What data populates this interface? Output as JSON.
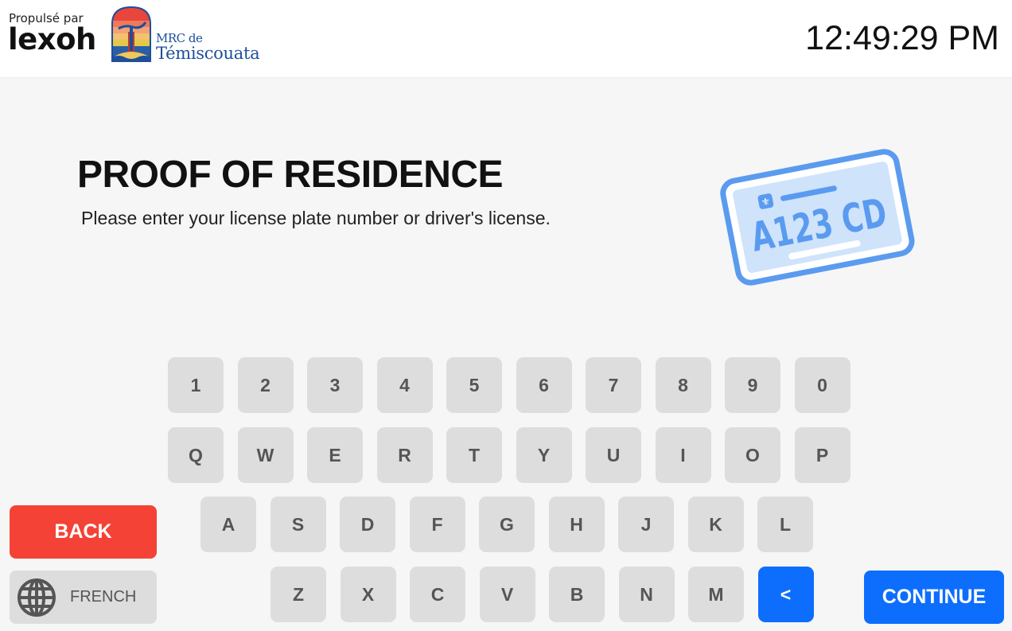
{
  "header": {
    "powered_by": "Propulsé par",
    "brand": "lexoh",
    "partner_logo_line1": "MRC de",
    "partner_logo_line2": "Témiscouata",
    "clock": "12:49:29 PM"
  },
  "main": {
    "title": "PROOF OF RESIDENCE",
    "subtitle": "Please enter your license plate number or driver's license.",
    "illustration_plate_text": "A123 CD"
  },
  "keyboard": {
    "rows": [
      [
        "1",
        "2",
        "3",
        "4",
        "5",
        "6",
        "7",
        "8",
        "9",
        "0"
      ],
      [
        "Q",
        "W",
        "E",
        "R",
        "T",
        "Y",
        "U",
        "I",
        "O",
        "P"
      ],
      [
        "A",
        "S",
        "D",
        "F",
        "G",
        "H",
        "J",
        "K",
        "L"
      ],
      [
        "Z",
        "X",
        "C",
        "V",
        "B",
        "N",
        "M"
      ]
    ],
    "backspace_label": "<"
  },
  "buttons": {
    "back": "BACK",
    "language": "FRENCH",
    "continue": "CONTINUE"
  },
  "colors": {
    "primary": "#0d6efd",
    "danger": "#f44336",
    "key_bg": "#dddddd",
    "key_text": "#555555",
    "page_bg": "#f6f6f6"
  }
}
